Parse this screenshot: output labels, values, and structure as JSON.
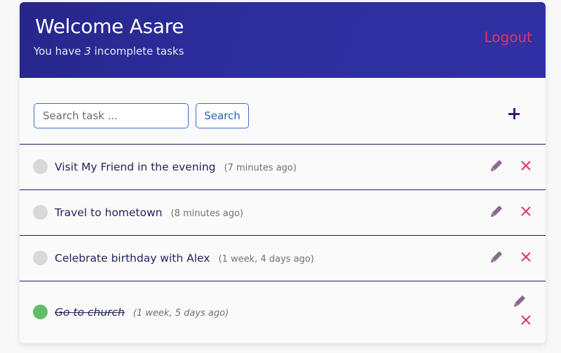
{
  "header": {
    "welcome": "Welcome Asare",
    "subtitle_prefix": "You have ",
    "incomplete_count": "3",
    "subtitle_suffix": " incomplete tasks",
    "logout_label": "Logout"
  },
  "toolbar": {
    "search_placeholder": "Search task ...",
    "search_value": "",
    "search_button": "Search",
    "add_icon": "plus-icon"
  },
  "colors": {
    "header_bg": "#2d2e9e",
    "logout": "#e0365f",
    "accent_blue": "#3a6fc8",
    "done_green": "#62bd6a",
    "pending_grey": "#d8d8d8",
    "edit_icon": "#8a6a8f",
    "delete_icon": "#e0365f"
  },
  "tasks": [
    {
      "title": "Visit My Friend in the evening",
      "time": "(7 minutes ago)",
      "completed": false,
      "edit_icon": "pencil-icon",
      "delete_icon": "close-icon"
    },
    {
      "title": "Travel to hometown",
      "time": "(8 minutes ago)",
      "completed": false,
      "edit_icon": "pencil-icon",
      "delete_icon": "close-icon"
    },
    {
      "title": "Celebrate birthday with Alex",
      "time": "(1 week, 4 days ago)",
      "completed": false,
      "edit_icon": "pencil-icon",
      "delete_icon": "close-icon"
    },
    {
      "title": "Go to church",
      "time": "(1 week, 5 days ago)",
      "completed": true,
      "edit_icon": "pencil-icon",
      "delete_icon": "close-icon"
    }
  ]
}
